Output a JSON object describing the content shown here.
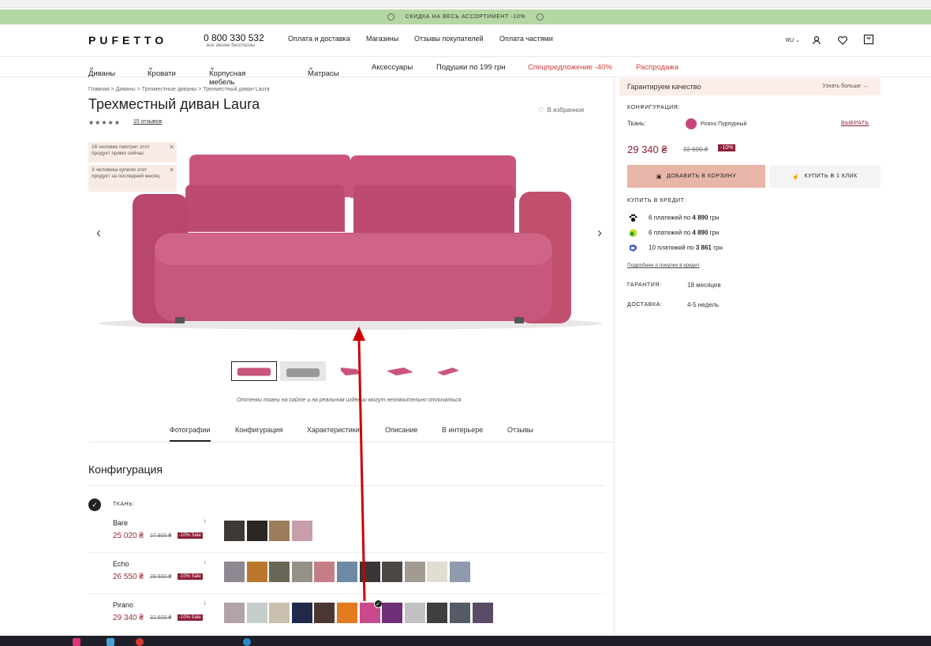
{
  "promo": {
    "text": "СКИДКА НА ВЕСЬ АССОРТИМЕНТ -10%"
  },
  "header": {
    "logo": "PUFETTO",
    "phone": "0 800 330 532",
    "phone_note": "все звонки бесплатны",
    "links": [
      "Оплата и доставка",
      "Магазины",
      "Отзывы покупателей",
      "Оплата частями"
    ],
    "lang": "RU"
  },
  "nav": {
    "items": [
      "Диваны",
      "Кровати",
      "Корпусная мебель",
      "Матрасы",
      "Аксессуары",
      "Подушки по 199 грн",
      "Спецпредложение -40%",
      "Распродажа"
    ]
  },
  "product": {
    "breadcrumbs": "Главная > Диваны > Трехместные диваны > Трехместный диван Laura",
    "title": "Трехместный диван Laura",
    "stars": "★★★★★",
    "reviews": "15 отзывов",
    "favorite": "В избранное",
    "notices": [
      "16 человек смотрит этот продукт прямо сейчас",
      "3 человека купили этот продукт за последний месяц"
    ],
    "disclaimer": "Оттенки ткани на сайте и на реальном изделии могут незначительно отличаться"
  },
  "tabs": [
    "Фотографии",
    "Конфигурация",
    "Характеристики",
    "Описание",
    "В интерьере",
    "Отзывы"
  ],
  "config": {
    "heading": "Конфигурация",
    "section_label": "ТКАНЬ:",
    "fabrics": [
      {
        "name": "Bare",
        "price": "25 020 ₴",
        "old": "27 800 ₴",
        "badge": "-10% Sale",
        "colors": [
          "#3d3a35",
          "#2e2622",
          "#9c7d5b",
          "#c79ea9"
        ]
      },
      {
        "name": "Echo",
        "price": "26 550 ₴",
        "old": "29 500 ₴",
        "badge": "-10% Sale",
        "colors": [
          "#8d8891",
          "#b9772b",
          "#6a6657",
          "#959188",
          "#c67e86",
          "#6c8aa4",
          "#3a3636",
          "#4a4745",
          "#a39a92",
          "#e2ddd2",
          "#8e9aae"
        ]
      },
      {
        "name": "Pirano",
        "price": "29 340 ₴",
        "old": "32 600 ₴",
        "badge": "-10% Sale",
        "colors": [
          "#b3a2a6",
          "#c6ccca",
          "#c9bfae",
          "#1f2a4a",
          "#4a3632",
          "#e27a1f",
          "#c94a8c",
          "#6f2e78",
          "#c2c2c4",
          "#3f3f41",
          "#545a66",
          "#5a4a66"
        ]
      }
    ]
  },
  "buy": {
    "guarantee": "Гарантируем качество",
    "learn_more": "Узнать больше →",
    "config_label": "КОНФИГУРАЦИЯ:",
    "fabric_label": "Ткань:",
    "fabric_value": "Pirano Пурпурный",
    "choose": "ВЫБРАТЬ",
    "price": "29 340 ₴",
    "old_price": "32 600 ₴",
    "discount": "-10%",
    "add_to_cart": "ДОБАВИТЬ В КОРЗИНУ",
    "one_click": "КУПИТЬ В 1 КЛИК",
    "credit_label": "КУПИТЬ В КРЕДИТ:",
    "credit": [
      {
        "count": "6",
        "text": "платежей по",
        "amount": "4 890",
        "cur": "грн"
      },
      {
        "count": "6",
        "text": "платежей по",
        "amount": "4 890",
        "cur": "грн"
      },
      {
        "count": "10",
        "text": "платежей по",
        "amount": "3 861",
        "cur": "грн"
      }
    ],
    "credit_more": "Подробнее о покупке в кредит",
    "warranty_label": "ГАРАНТИЯ:",
    "warranty": "18 месяцев",
    "delivery_label": "ДОСТАВКА:",
    "delivery": "4-5 недель"
  },
  "colors": {
    "accent": "#8c1e35",
    "promo": "#b5d7a3",
    "cart": "#e8b6a8",
    "annotation": "#cc0000"
  }
}
